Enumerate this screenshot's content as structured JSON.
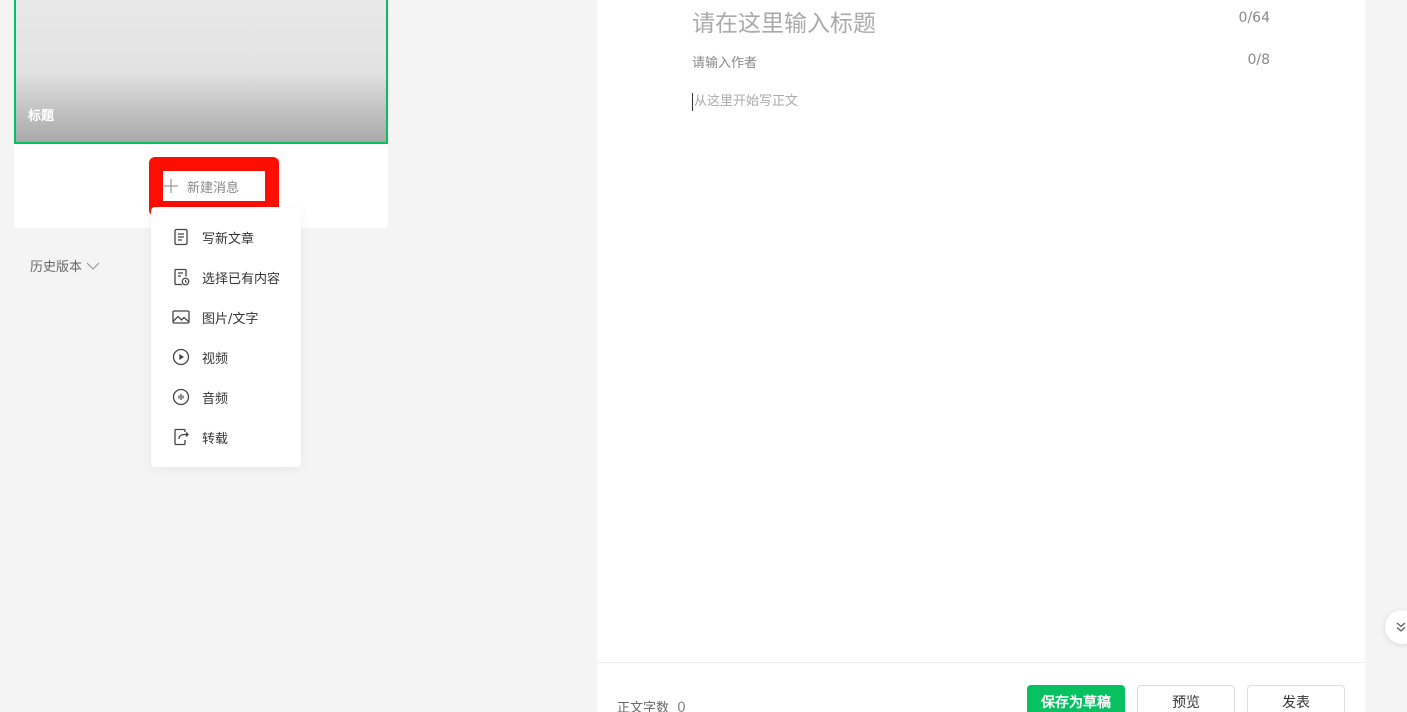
{
  "left_panel": {
    "cover_title": "标题",
    "new_message_label": "新建消息",
    "history_label": "历史版本"
  },
  "dropdown": {
    "items": [
      {
        "label": "写新文章",
        "icon": "document-icon"
      },
      {
        "label": "选择已有内容",
        "icon": "document-clock-icon"
      },
      {
        "label": "图片/文字",
        "icon": "image-icon"
      },
      {
        "label": "视频",
        "icon": "play-icon"
      },
      {
        "label": "音频",
        "icon": "audio-icon"
      },
      {
        "label": "转载",
        "icon": "share-icon"
      }
    ]
  },
  "editor": {
    "title_placeholder": "请在这里输入标题",
    "title_count": "0/64",
    "author_placeholder": "请输入作者",
    "author_count": "0/8",
    "body_placeholder": "从这里开始写正文"
  },
  "footer": {
    "wordcount_label": "正文字数",
    "wordcount_value": "0",
    "save_label": "保存为草稿",
    "preview_label": "预览",
    "publish_label": "发表"
  },
  "colors": {
    "accent": "#07c160",
    "highlight": "#ff0d00"
  }
}
